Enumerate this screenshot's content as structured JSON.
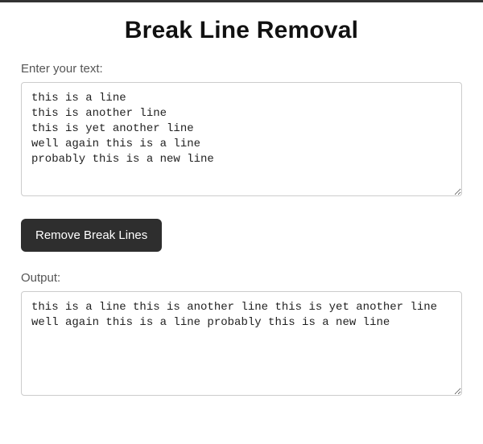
{
  "title": "Break Line Removal",
  "input": {
    "label": "Enter your text:",
    "value": "this is a line\nthis is another line\nthis is yet another line\nwell again this is a line\nprobably this is a new line"
  },
  "button": {
    "label": "Remove Break Lines"
  },
  "output": {
    "label": "Output:",
    "value": "this is a line this is another line this is yet another line well again this is a line probably this is a new line"
  }
}
